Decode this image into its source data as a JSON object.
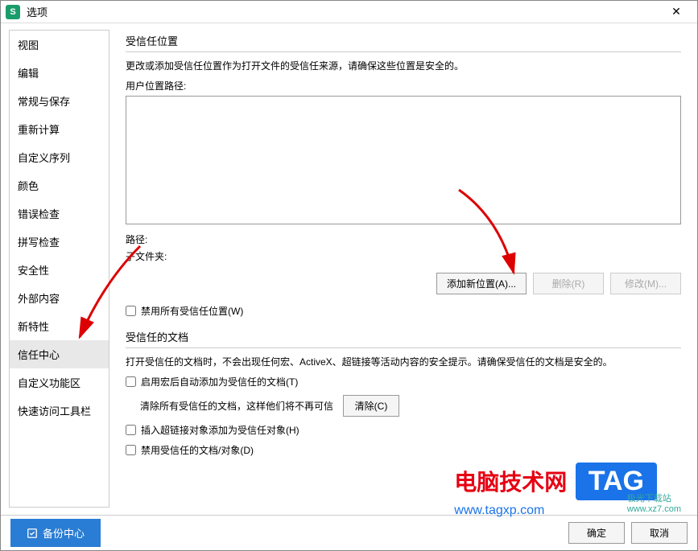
{
  "titlebar": {
    "app_letter": "S",
    "title": "选项"
  },
  "sidebar": {
    "items": [
      {
        "label": "视图"
      },
      {
        "label": "编辑"
      },
      {
        "label": "常规与保存"
      },
      {
        "label": "重新计算"
      },
      {
        "label": "自定义序列"
      },
      {
        "label": "颜色"
      },
      {
        "label": "错误检查"
      },
      {
        "label": "拼写检查"
      },
      {
        "label": "安全性"
      },
      {
        "label": "外部内容"
      },
      {
        "label": "新特性"
      },
      {
        "label": "信任中心"
      },
      {
        "label": "自定义功能区"
      },
      {
        "label": "快速访问工具栏"
      }
    ],
    "active_index": 11
  },
  "trusted": {
    "section_title": "受信任位置",
    "desc": "更改或添加受信任位置作为打开文件的受信任来源，请确保这些位置是安全的。",
    "user_path_label": "用户位置路径:",
    "path_label": "路径:",
    "subfolder_label": "子文件夹:",
    "add_btn": "添加新位置(A)...",
    "delete_btn": "删除(R)",
    "modify_btn": "修改(M)...",
    "disable_all_label": "禁用所有受信任位置(W)"
  },
  "docs": {
    "section_title": "受信任的文档",
    "desc": "打开受信任的文档时，不会出现任何宏、ActiveX、超链接等活动内容的安全提示。请确保受信任的文档是安全的。",
    "auto_add_label": "启用宏后自动添加为受信任的文档(T)",
    "clear_desc": "清除所有受信任的文档，这样他们将不再可信",
    "clear_btn": "清除(C)",
    "hyperlink_label": "插入超链接对象添加为受信任对象(H)",
    "disable_label": "禁用受信任的文档/对象(D)"
  },
  "footer": {
    "backup": "备份中心",
    "ok": "确定",
    "cancel": "取消"
  },
  "watermark": {
    "red": "电脑技术网",
    "tag": "TAG",
    "url": "www.tagxp.com",
    "small1": "极光下载站",
    "small2": "www.xz7.com"
  }
}
